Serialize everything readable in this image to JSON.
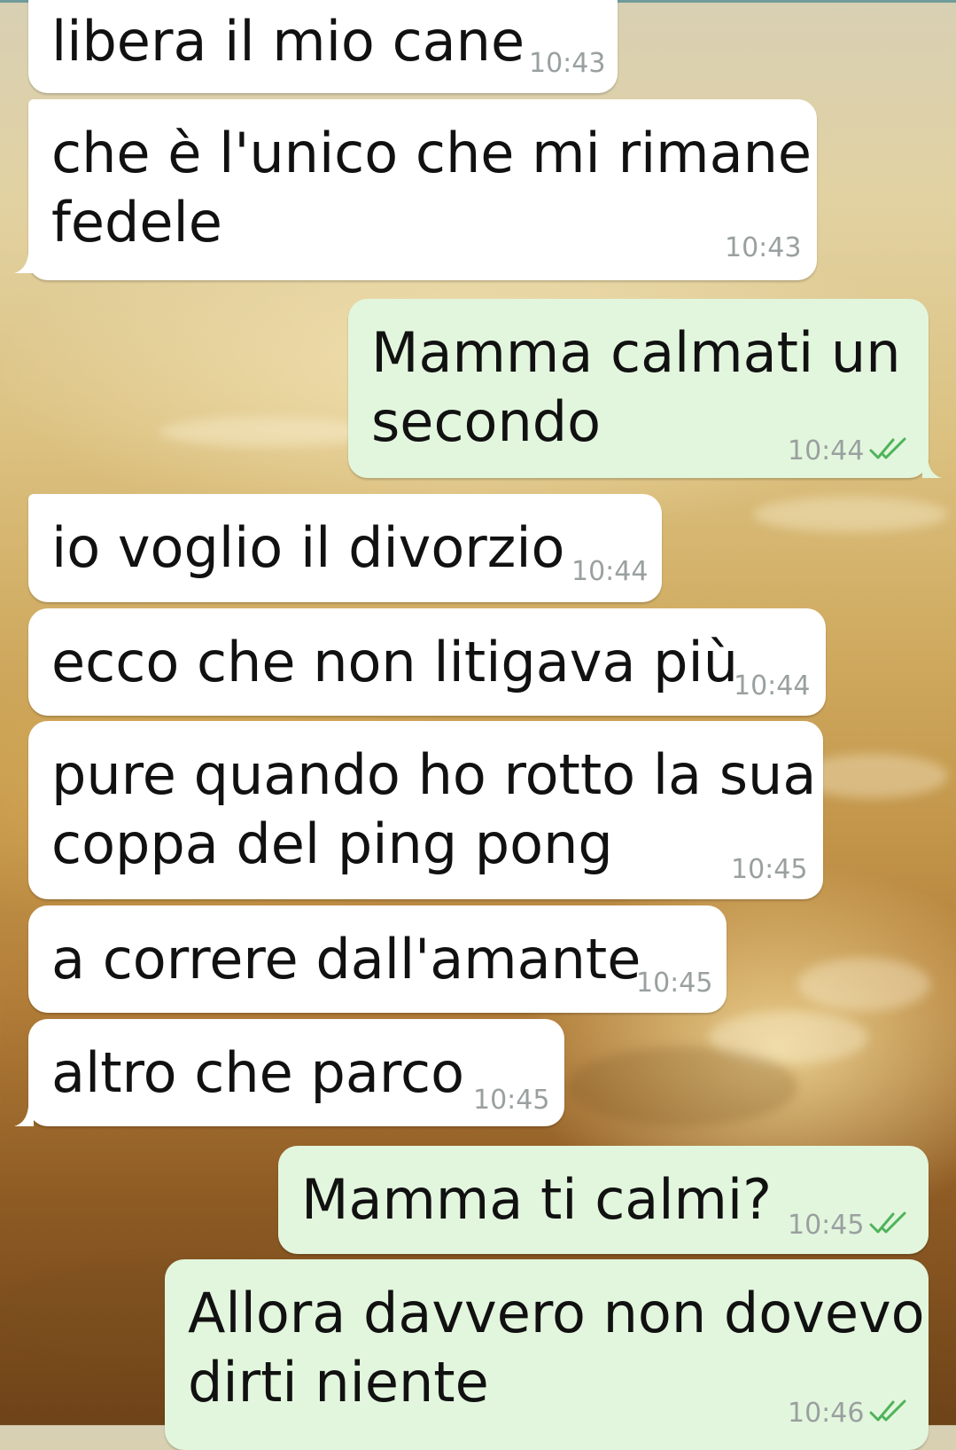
{
  "chat": {
    "messages": [
      {
        "direction": "in",
        "lines": [
          "libera il mio cane"
        ],
        "time": "10:43"
      },
      {
        "direction": "in",
        "lines": [
          "che è l'unico che mi rimane",
          "fedele"
        ],
        "time": "10:43"
      },
      {
        "direction": "out",
        "lines": [
          "Mamma calmati un",
          "secondo"
        ],
        "time": "10:44",
        "status": "read-double-check-icon"
      },
      {
        "direction": "in",
        "lines": [
          "io voglio il divorzio"
        ],
        "time": "10:44"
      },
      {
        "direction": "in",
        "lines": [
          "ecco che non litigava più"
        ],
        "time": "10:44"
      },
      {
        "direction": "in",
        "lines": [
          "pure quando ho rotto la sua",
          "coppa del ping pong"
        ],
        "time": "10:45"
      },
      {
        "direction": "in",
        "lines": [
          "a correre dall'amante"
        ],
        "time": "10:45"
      },
      {
        "direction": "in",
        "lines": [
          "altro che parco"
        ],
        "time": "10:45"
      },
      {
        "direction": "out",
        "lines": [
          "Mamma ti calmi?"
        ],
        "time": "10:45",
        "status": "read-double-check-icon"
      },
      {
        "direction": "out",
        "lines": [
          "Allora davvero non dovevo",
          "dirti niente"
        ],
        "time": "10:46",
        "status": "read-double-check-icon"
      }
    ]
  },
  "colors": {
    "incoming_bubble": "#ffffff",
    "outgoing_bubble": "#e2f6dd",
    "timestamp": "#9aa0a0",
    "read_ticks": "#4fb35a"
  }
}
